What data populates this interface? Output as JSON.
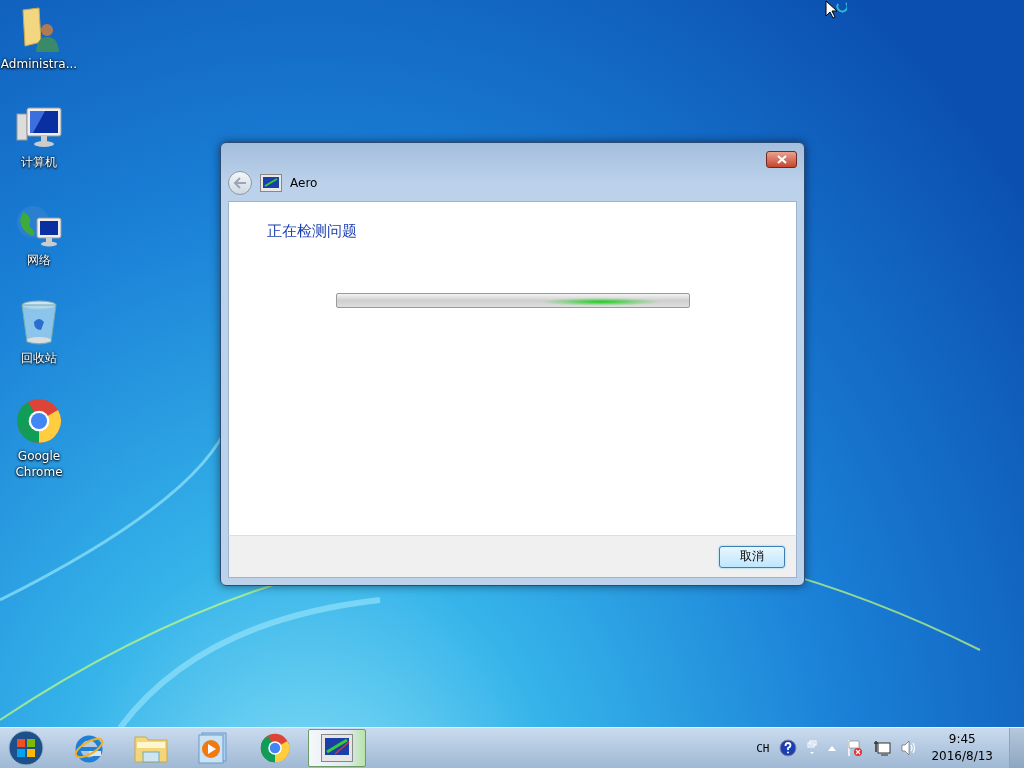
{
  "desktop": {
    "icons": [
      {
        "kind": "user-folder",
        "label": "Administra..."
      },
      {
        "kind": "computer",
        "label": "计算机"
      },
      {
        "kind": "network",
        "label": "网络"
      },
      {
        "kind": "recycle-bin",
        "label": "回收站"
      },
      {
        "kind": "chrome",
        "label": "Google Chrome"
      }
    ]
  },
  "dialog": {
    "title": "Aero",
    "heading": "正在检测问题",
    "progress": {
      "indeterminate": true
    },
    "cancel_button": "取消"
  },
  "taskbar": {
    "items": [
      {
        "kind": "ie",
        "active": false
      },
      {
        "kind": "explorer",
        "active": false
      },
      {
        "kind": "media-player",
        "active": false
      },
      {
        "kind": "chrome",
        "active": false
      },
      {
        "kind": "aero",
        "active": true
      }
    ],
    "tray": {
      "language": "CH",
      "time": "9:45",
      "date": "2016/8/13"
    }
  }
}
